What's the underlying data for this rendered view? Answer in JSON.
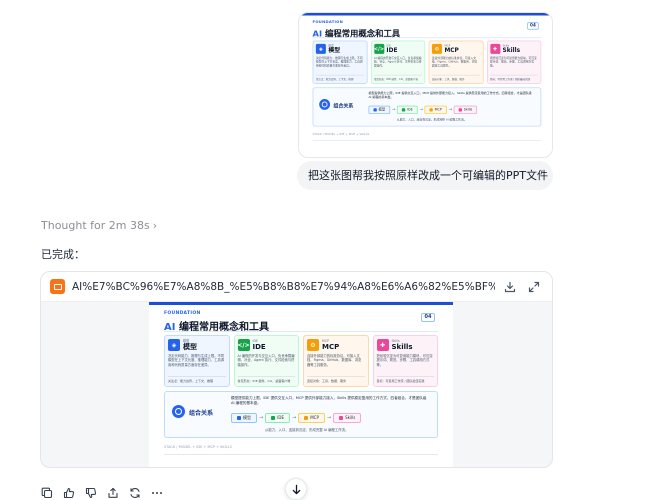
{
  "conversation": {
    "user_message": "把这张图帮我按照原样改成一个可编辑的PPT文件",
    "thought_label": "Thought for 2m 38s",
    "assistant_text": "已完成：",
    "file": {
      "name": "AI%E7%BC%96%E7%A8%8B_%E5%B8%B8%E7%94%A8%E6%A6%82%E5%BF%B5%E5%...",
      "type_icon": "ppt-file-icon"
    }
  },
  "slide": {
    "eyebrow": "FOUNDATION",
    "title_prefix": "AI",
    "title_rest": " 编程常用概念和工具",
    "page_number": "04",
    "cards": [
      {
        "tag": "模型",
        "name": "模型",
        "icon_color": "#2563eb",
        "icon_glyph": "◈",
        "desc": "决定代码能力、推理与生成上限。不同模型在上下文长度、推理能力、工具调用和代码质量方面存在差异。",
        "foot": "关注点：能力边界、上下文、推理"
      },
      {
        "tag": "IDE",
        "name": "IDE",
        "icon_color": "#16a34a",
        "icon_glyph": "</>",
        "desc": "AI 编程的开发与交互入口，负责承载编辑、补全、Agent 执行、文件检索与终端操作。",
        "foot": "常见形态：IDE 插件、CLI、桌面客户端"
      },
      {
        "tag": "MCP",
        "name": "MCP",
        "icon_color": "#f59e0b",
        "icon_glyph": "⚙",
        "desc": "连接外部能力的标准协议。可接入文档、Figma、GitHub、数据库、浏览器等工具服务。",
        "foot": "连接对象：工具、数据、服务"
      },
      {
        "tag": "Skills",
        "name": "Skills",
        "icon_color": "#ec4899",
        "icon_glyph": "✚",
        "desc": "把经验沉淀为可复用能力模块，可沉淀提示词、规范、步骤、工具调用方式等。",
        "foot": "目标：可复用工作流 / 团队最佳实践"
      }
    ],
    "combo": {
      "label": "组合关系",
      "desc": "模型提供能力上限，IDE 提供交互入口，MCP 提供外部能力接入，Skills 提供稳定复用的工作方式。四者组合，才是团队级 AI 编程的基本盘。",
      "flow": [
        {
          "label": "模型",
          "color": "#2563eb"
        },
        {
          "label": "IDE",
          "color": "#16a34a"
        },
        {
          "label": "MCP",
          "color": "#f59e0b"
        },
        {
          "label": "Skills",
          "color": "#ec4899"
        }
      ],
      "flow_note": "从能力、入口、连接到沉淀，形成完整 AI 编程工作流。"
    },
    "footer": "STACK / MODEL + IDE + MCP + SKILLS"
  },
  "actions": [
    {
      "name": "copy-icon"
    },
    {
      "name": "thumbs-up-icon"
    },
    {
      "name": "thumbs-down-icon"
    },
    {
      "name": "share-icon"
    },
    {
      "name": "retry-icon"
    },
    {
      "name": "more-icon"
    }
  ]
}
